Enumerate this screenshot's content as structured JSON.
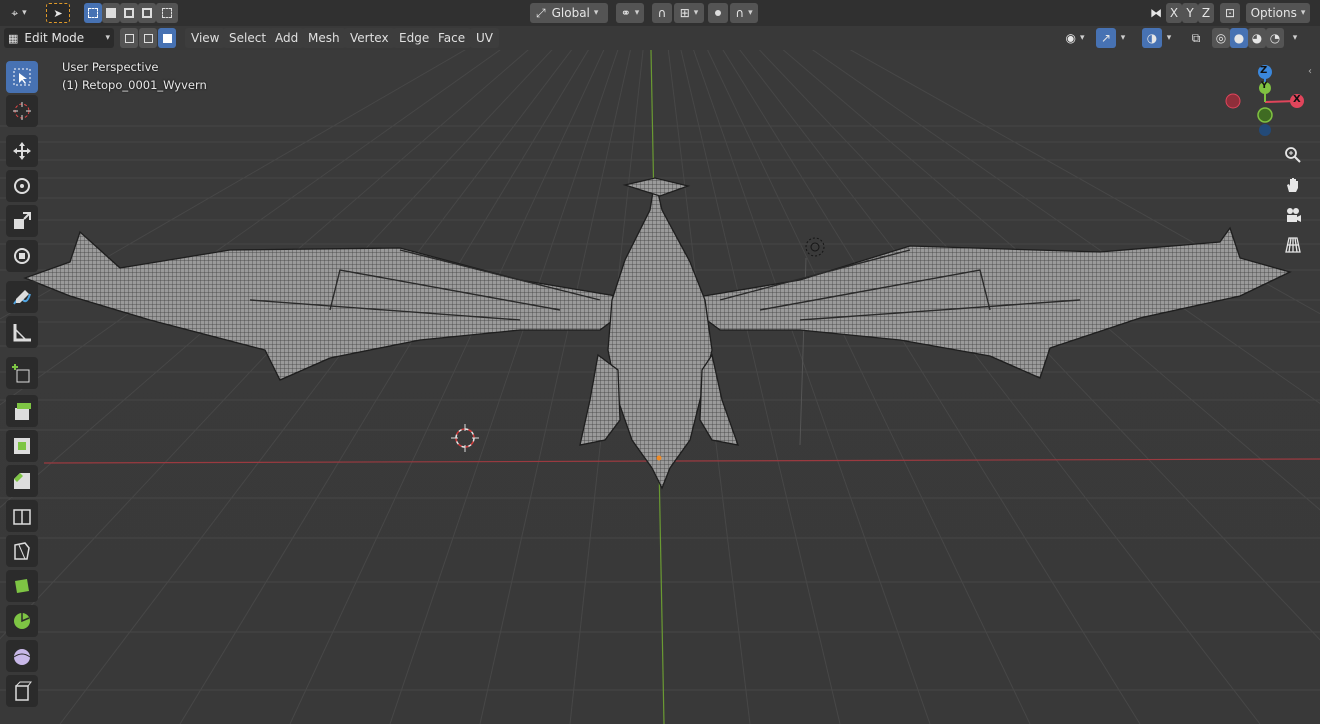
{
  "header": {
    "transform_orientation": "Global",
    "axis_x": "X",
    "axis_y": "Y",
    "axis_z": "Z",
    "options_label": "Options"
  },
  "subheader": {
    "mode_label": "Edit Mode",
    "menus": [
      "View",
      "Select",
      "Add",
      "Mesh",
      "Vertex",
      "Edge",
      "Face",
      "UV"
    ]
  },
  "viewport": {
    "view_name": "User Perspective",
    "object_name": "(1) Retopo_0001_Wyvern"
  },
  "gizmo": {
    "z_label": "Z",
    "y_label": "Y",
    "x_label": "X"
  },
  "colors": {
    "accent": "#4772b3",
    "x_axis": "#e0455b",
    "y_axis": "#7fc141",
    "z_axis": "#3b87db"
  },
  "icons": {
    "toolbar": [
      "select-box-icon",
      "cursor-icon",
      "move-icon",
      "rotate-icon",
      "scale-icon",
      "transform-icon",
      "annotate-icon",
      "measure-icon",
      "add-cube-icon",
      "extrude-icon",
      "inset-icon",
      "bevel-icon",
      "loop-cut-icon",
      "knife-icon",
      "poly-build-icon",
      "spin-icon",
      "smooth-icon",
      "shrink-icon"
    ],
    "nav": [
      "zoom-icon",
      "pan-hand-icon",
      "camera-icon",
      "grid-perspective-icon"
    ]
  }
}
